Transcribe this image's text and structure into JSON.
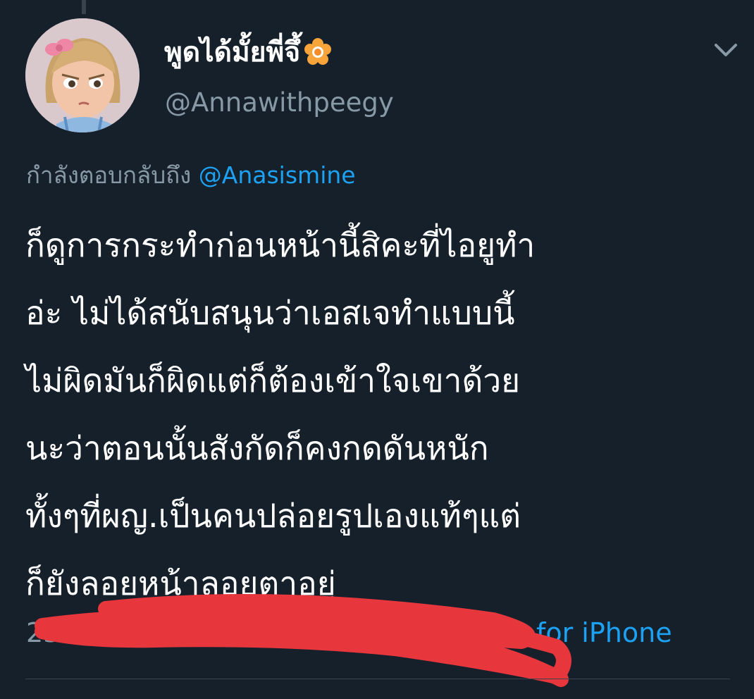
{
  "tweet": {
    "author": {
      "display_name": "พูดได้มั้ยพี่จึ้",
      "handle": "@Annawithpeegy",
      "avatar_icon": "cartoon-girl-avatar",
      "name_emoji_icon": "flower-icon"
    },
    "reply_to": {
      "prefix": "กำลังตอบกลับถึง ",
      "mention": "@Anasismine"
    },
    "text_lines": [
      "ก็ดูการกระทำก่อนหน้านี้สิคะที่ไอยูทำ",
      "อ่ะ ไม่ได้สนับสนุนว่าเอสเจทำแบบนี้",
      "ไม่ผิดมันก็ผิดแต่ก็ต้องเข้าใจเขาด้วย",
      "นะว่าตอนนั้นสังกัดก็คงกดดันหนัก",
      "ทั้งๆที่ผญ.เป็นคนปล่อยรูปเองแท้ๆแต่",
      "ก็ยังลอยหน้าลอยตาอยู่"
    ],
    "meta": {
      "time_partial": "23.2",
      "source_partial": "ter for iPhone"
    },
    "menu_icon": "chevron-down-icon",
    "colors": {
      "background": "#15202b",
      "secondary_text": "#8899a6",
      "link": "#1da1f2",
      "redaction": "#e8363d"
    }
  }
}
